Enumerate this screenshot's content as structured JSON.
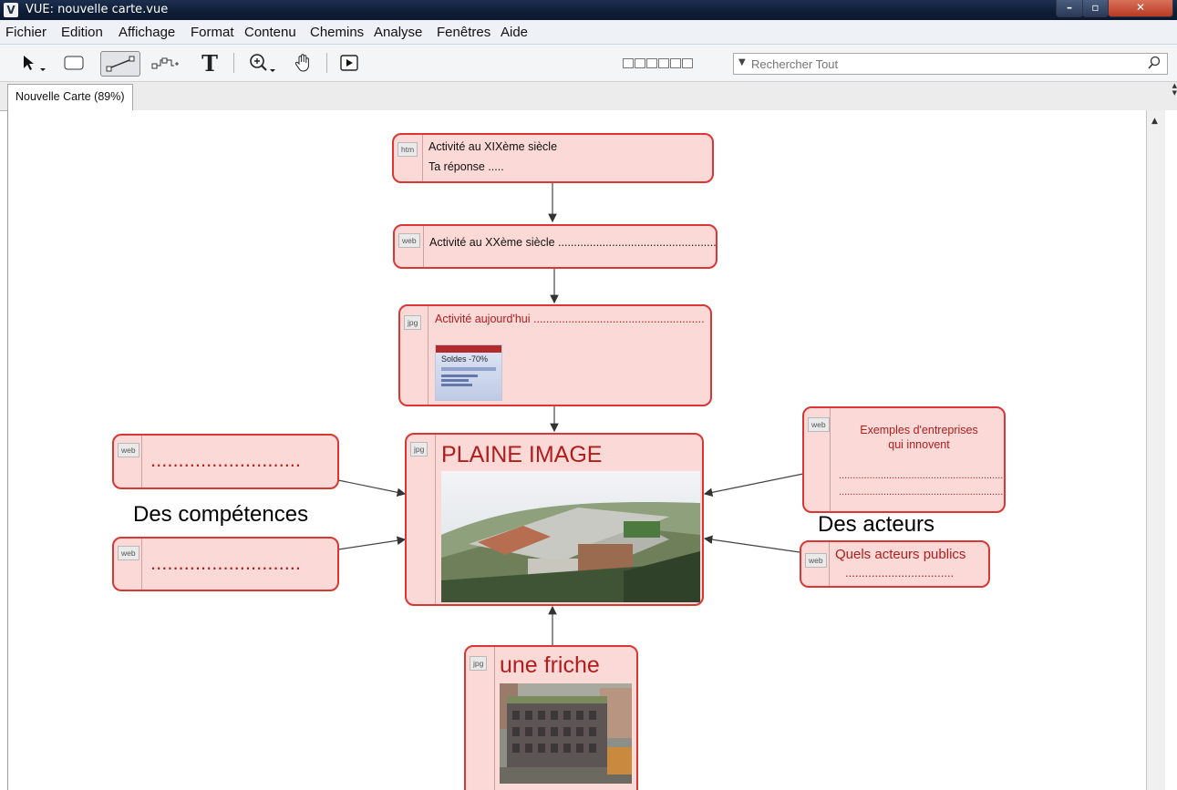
{
  "window": {
    "title": "VUE: nouvelle carte.vue",
    "app_icon": "V"
  },
  "menu": [
    "Fichier",
    "Edition",
    "Affichage",
    "Format",
    "Contenu",
    "Chemins",
    "Analyse",
    "Fenêtres",
    "Aide"
  ],
  "toolbar": {
    "tools": [
      "select-arrow-icon",
      "rectangle-node-icon",
      "link-tool-icon",
      "merge-link-icon",
      "text-tool-icon",
      "zoom-icon",
      "hand-pan-icon",
      "presentation-play-icon"
    ],
    "path_slots": 6
  },
  "search": {
    "placeholder": "Rechercher Tout"
  },
  "tab": {
    "label": "Nouvelle Carte (89%)"
  },
  "nodes": {
    "n1": {
      "badge": "htm",
      "line1": "Activité au XIXème siècle",
      "line2": "Ta réponse ....."
    },
    "n2": {
      "badge": "web",
      "line1": "Activité au XXème siècle ......................................................"
    },
    "n3": {
      "badge": "jpg",
      "line1": "Activité aujourd'hui ......................................................",
      "thumb": "Soldes -70%"
    },
    "plaine": {
      "badge": "jpg",
      "title": "PLAINE IMAGE"
    },
    "left1": {
      "badge": "web",
      "dots": "..........................."
    },
    "left2": {
      "badge": "web",
      "dots": "..........................."
    },
    "ent": {
      "badge": "web",
      "line1": "Exemples d'entreprises",
      "line2": "qui innovent",
      "dots1": ".........................................................................",
      "dots2": "........................................................................."
    },
    "acteurs": {
      "badge": "web",
      "line1": "Quels acteurs publics",
      "dots": "................................."
    },
    "friche": {
      "badge": "jpg",
      "title": "une friche"
    }
  },
  "labels": {
    "competences": "Des compétences",
    "acteurs": "Des acteurs"
  },
  "colors": {
    "node_fill": "#fbd9d6",
    "node_border": "#d93636",
    "node_text_red": "#b01e1e"
  }
}
